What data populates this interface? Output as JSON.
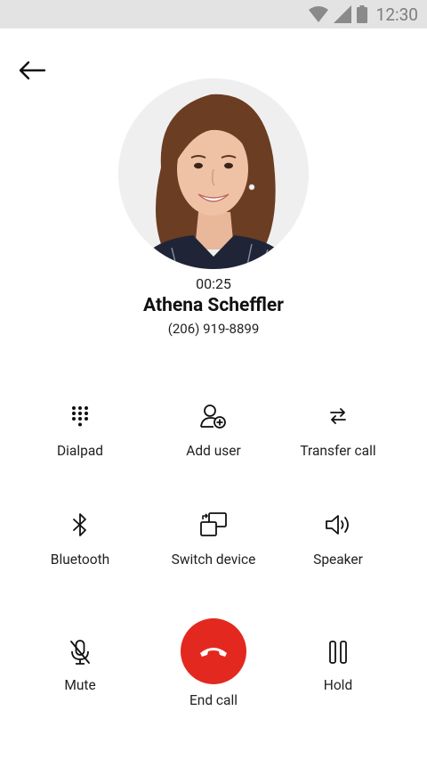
{
  "status_bar": {
    "time": "12:30",
    "icons": [
      "wifi-icon",
      "signal-icon",
      "battery-icon"
    ]
  },
  "call": {
    "duration": "00:25",
    "contact_name": "Athena Scheffler",
    "phone_number": "(206) 919-8899"
  },
  "actions": {
    "dialpad": "Dialpad",
    "add_user": "Add user",
    "transfer_call": "Transfer call",
    "bluetooth": "Bluetooth",
    "switch_device": "Switch device",
    "speaker": "Speaker",
    "mute": "Mute",
    "end_call": "End call",
    "hold": "Hold"
  },
  "colors": {
    "end_call": "#e3291f",
    "status_bar": "#e3e3e3"
  }
}
